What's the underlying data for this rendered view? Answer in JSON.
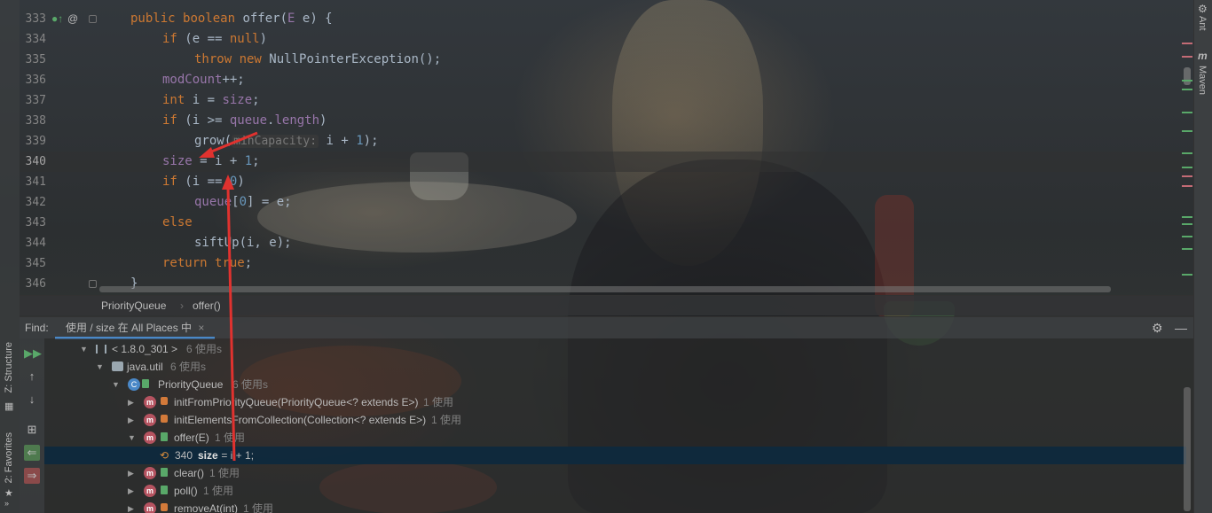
{
  "editor": {
    "current_line": "340",
    "lines": [
      {
        "n": "333",
        "pre": "",
        "parts": [
          [
            "kw",
            "public "
          ],
          [
            "kw",
            "boolean "
          ],
          [
            "t",
            "offer("
          ],
          [
            "fld",
            "E"
          ],
          [
            "t",
            " e) {"
          ]
        ]
      },
      {
        "n": "334",
        "parts": [
          [
            "kw",
            "if "
          ],
          [
            "t",
            "(e == "
          ],
          [
            "kw",
            "null"
          ],
          [
            "t",
            ")"
          ]
        ]
      },
      {
        "n": "335",
        "parts": [
          [
            "kw",
            "throw new "
          ],
          [
            "t",
            "NullPointerException();"
          ]
        ]
      },
      {
        "n": "336",
        "parts": [
          [
            "fld",
            "modCount"
          ],
          [
            "t",
            "++;"
          ]
        ]
      },
      {
        "n": "337",
        "parts": [
          [
            "kw",
            "int "
          ],
          [
            "t",
            "i = "
          ],
          [
            "fld",
            "size"
          ],
          [
            "t",
            ";"
          ]
        ]
      },
      {
        "n": "338",
        "parts": [
          [
            "kw",
            "if "
          ],
          [
            "t",
            "(i >= "
          ],
          [
            "fld",
            "queue"
          ],
          [
            "t",
            "."
          ],
          [
            "fld",
            "length"
          ],
          [
            "t",
            ")"
          ]
        ]
      },
      {
        "n": "339",
        "parts": [
          [
            "t",
            "grow("
          ],
          [
            "hint",
            "minCapacity:"
          ],
          [
            "t",
            " i + "
          ],
          [
            "num",
            "1"
          ],
          [
            "t",
            ");"
          ]
        ]
      },
      {
        "n": "340",
        "parts": [
          [
            "fld",
            "size "
          ],
          [
            "t",
            "= i + "
          ],
          [
            "num",
            "1"
          ],
          [
            "t",
            ";"
          ]
        ]
      },
      {
        "n": "341",
        "parts": [
          [
            "kw",
            "if "
          ],
          [
            "t",
            "(i == "
          ],
          [
            "num",
            "0"
          ],
          [
            "t",
            ")"
          ]
        ]
      },
      {
        "n": "342",
        "parts": [
          [
            "fld",
            "queue"
          ],
          [
            "t",
            "["
          ],
          [
            "num",
            "0"
          ],
          [
            "t",
            "] = e;"
          ]
        ]
      },
      {
        "n": "343",
        "parts": [
          [
            "kw",
            "else"
          ]
        ]
      },
      {
        "n": "344",
        "parts": [
          [
            "t",
            "siftUp(i, e);"
          ]
        ]
      },
      {
        "n": "345",
        "parts": [
          [
            "kw",
            "return "
          ],
          [
            "kw",
            "true"
          ],
          [
            "t",
            ";"
          ]
        ]
      },
      {
        "n": "346",
        "parts": [
          [
            "t",
            "}"
          ]
        ]
      }
    ]
  },
  "breadcrumb": {
    "class_name": "PriorityQueue",
    "method_name": "offer()"
  },
  "find": {
    "label": "Find:",
    "tab_title": "使用 / size 在 All Places 中",
    "tab_close": "×",
    "tree": {
      "jdk": {
        "label": "< 1.8.0_301 >",
        "count": "6 使用s"
      },
      "package": {
        "label": "java.util",
        "count": "6 使用s"
      },
      "class": {
        "label": "PriorityQueue",
        "count": "6 使用s"
      },
      "methods": [
        {
          "label": "initFromPriorityQueue(PriorityQueue<? extends E>)",
          "count": "1 使用",
          "access": "private"
        },
        {
          "label": "initElementsFromCollection(Collection<? extends E>)",
          "count": "1 使用",
          "access": "private"
        },
        {
          "label": "offer(E)",
          "count": "1 使用",
          "access": "public"
        },
        {
          "label": "clear()",
          "count": "1 使用",
          "access": "public"
        },
        {
          "label": "poll()",
          "count": "1 使用",
          "access": "public"
        },
        {
          "label": "removeAt(int)",
          "count": "1 使用",
          "access": "private"
        }
      ],
      "usage": {
        "line": "340",
        "field": "size",
        "rest": " = i + 1;"
      }
    }
  },
  "sidebars": {
    "right": {
      "ant": "Ant",
      "maven": "Maven"
    },
    "left": {
      "structure": "Z: Structure",
      "favorites": "2: Favorites"
    }
  },
  "colors": {
    "keyword": "#cc7832",
    "field": "#9876aa",
    "number": "#6897bb",
    "text": "#a9b7c6",
    "selection": "#0d293e",
    "annotation": "#e0322f"
  }
}
